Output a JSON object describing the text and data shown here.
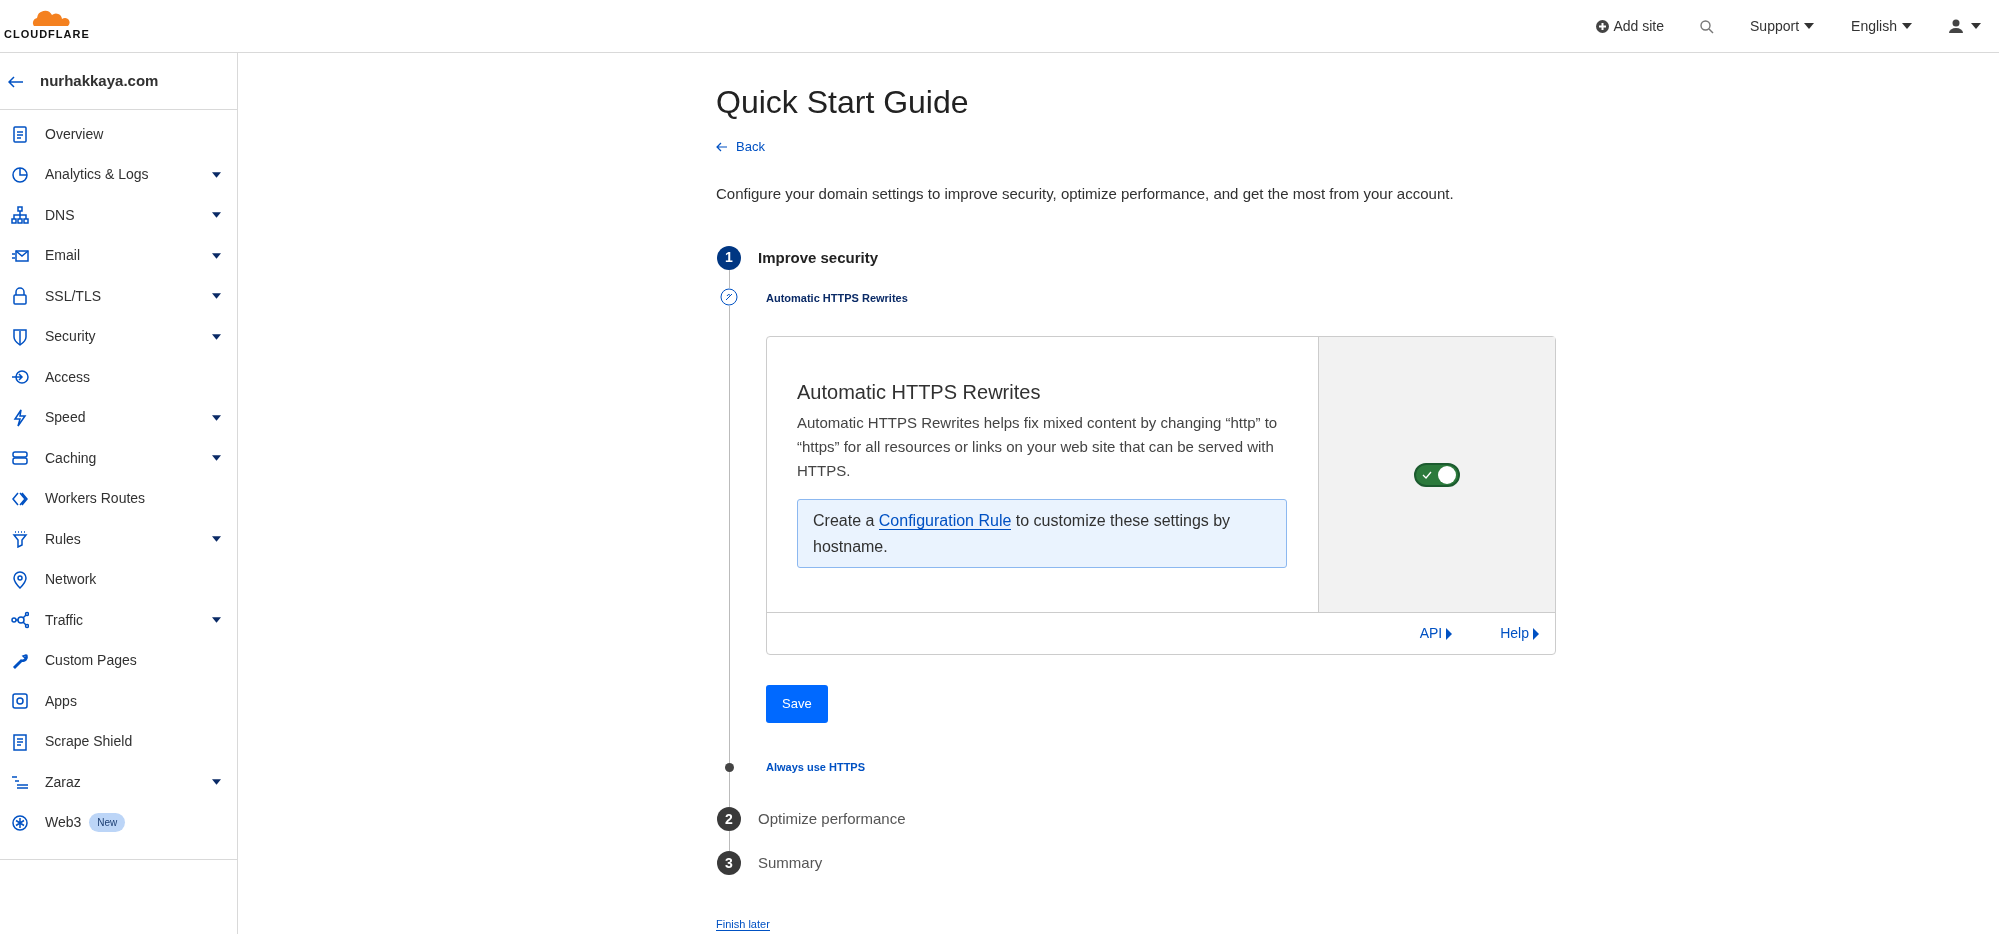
{
  "header": {
    "logo": "CLOUDFLARE",
    "add_site": "Add site",
    "support": "Support",
    "language": "English"
  },
  "sidebar": {
    "domain": "nurhakkaya.com",
    "items": [
      {
        "label": "Overview",
        "expandable": false
      },
      {
        "label": "Analytics & Logs",
        "expandable": true
      },
      {
        "label": "DNS",
        "expandable": true
      },
      {
        "label": "Email",
        "expandable": true
      },
      {
        "label": "SSL/TLS",
        "expandable": true
      },
      {
        "label": "Security",
        "expandable": true
      },
      {
        "label": "Access",
        "expandable": false
      },
      {
        "label": "Speed",
        "expandable": true
      },
      {
        "label": "Caching",
        "expandable": true
      },
      {
        "label": "Workers Routes",
        "expandable": false
      },
      {
        "label": "Rules",
        "expandable": true
      },
      {
        "label": "Network",
        "expandable": false
      },
      {
        "label": "Traffic",
        "expandable": true
      },
      {
        "label": "Custom Pages",
        "expandable": false
      },
      {
        "label": "Apps",
        "expandable": false
      },
      {
        "label": "Scrape Shield",
        "expandable": false
      },
      {
        "label": "Zaraz",
        "expandable": true
      },
      {
        "label": "Web3",
        "expandable": false,
        "badge": "New"
      }
    ]
  },
  "page": {
    "title": "Quick Start Guide",
    "back": "Back",
    "description": "Configure your domain settings to improve security, optimize performance, and get the most from your account.",
    "steps": [
      {
        "number": "1",
        "label": "Improve security",
        "current": true,
        "substeps": [
          {
            "label": "Automatic HTTPS Rewrites",
            "current": true,
            "card": {
              "title": "Automatic HTTPS Rewrites",
              "text": "Automatic HTTPS Rewrites helps fix mixed content by changing “http” to “https” for all resources or links on your web site that can be served with HTTPS.",
              "note_before": "Create a",
              "note_link": "Configuration Rule",
              "note_after": "to customize these settings by hostname.",
              "on": true,
              "links": [
                "API",
                "Help"
              ]
            },
            "save": "Save"
          },
          {
            "label": "Always use HTTPS",
            "current": false
          }
        ]
      },
      {
        "number": "2",
        "label": "Optimize performance",
        "current": false
      },
      {
        "number": "3",
        "label": "Summary",
        "current": false
      }
    ],
    "finish_later": "Finish later"
  }
}
